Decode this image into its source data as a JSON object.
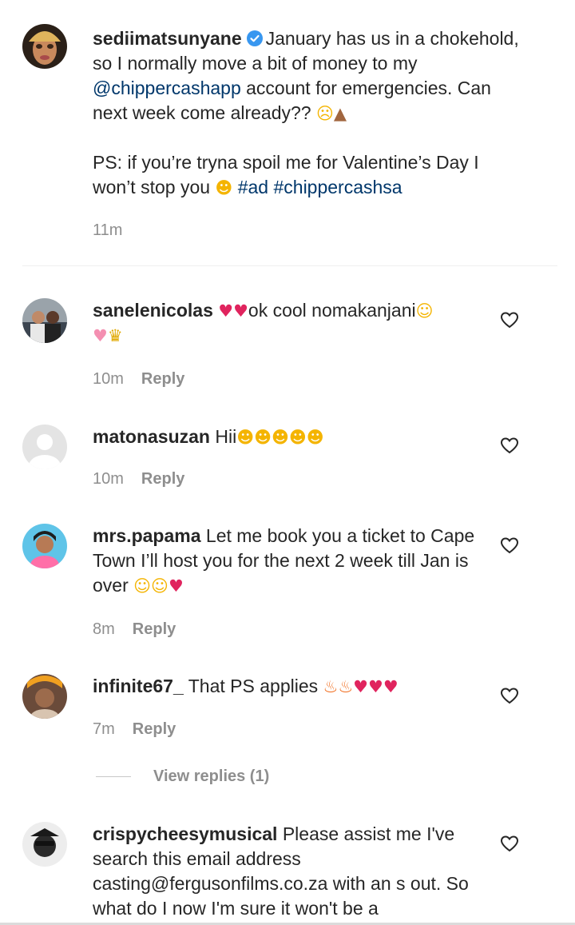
{
  "caption": {
    "username": "sediimatsunyane",
    "text_1": "January has us in a chokehold, so I normally move a bit of money to my",
    "mention": "@chippercashapp",
    "text_2": "account for emergencies. Can next week come already??",
    "text_3": "PS: if you’re tryna spoil me for Valentine’s Day I won’t stop you",
    "hashtags": "#ad #chippercashsa",
    "time": "11m"
  },
  "comments": [
    {
      "username": "sanelenicolas",
      "text": "ok cool nomakanjani",
      "time": "10m",
      "reply_label": "Reply"
    },
    {
      "username": "matonasuzan",
      "text": "Hii",
      "time": "10m",
      "reply_label": "Reply"
    },
    {
      "username": "mrs.papama",
      "text": "Let me book you a ticket to Cape Town I’ll host you for the next 2 week till Jan is over",
      "time": "8m",
      "reply_label": "Reply"
    },
    {
      "username": "infinite67_",
      "text": "That PS applies",
      "time": "7m",
      "reply_label": "Reply"
    },
    {
      "username": "crispycheesymusical",
      "text": "Please assist me I've search this email address casting@fergusonfilms.co.za with an s out. So what do I now I'm sure it won't be a"
    }
  ],
  "view_replies_label": "View replies (1)",
  "colors": {
    "link": "#00376b",
    "muted": "#8e8e8e",
    "text": "#262626",
    "verified": "#3897f0"
  },
  "icons": [
    "verified-badge-icon",
    "heart-outline-icon"
  ]
}
